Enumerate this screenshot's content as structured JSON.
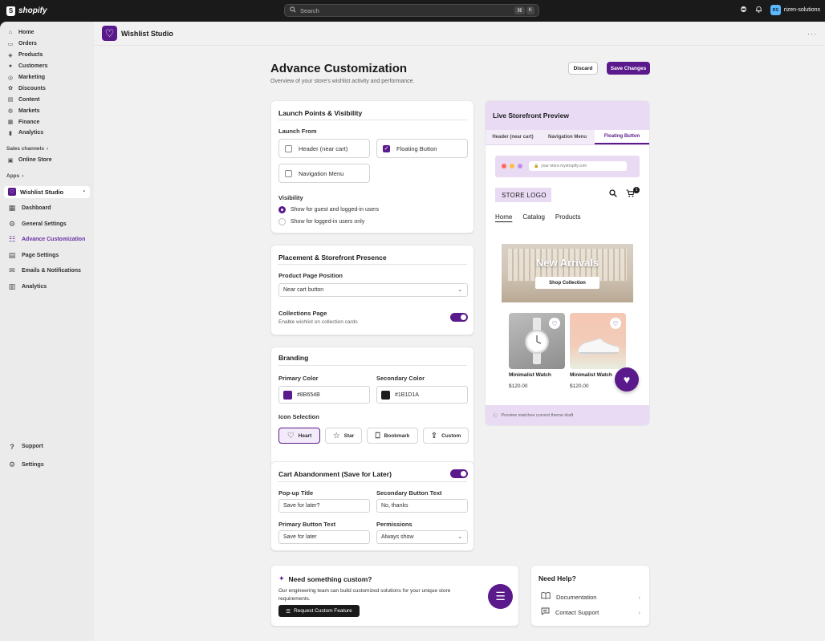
{
  "topbar": {
    "brand": "shopify",
    "search_placeholder": "Search",
    "kbd": [
      "⌘",
      "K"
    ],
    "account_initials": "RS",
    "account_name": "rizen-solutions"
  },
  "sidebar": {
    "items": [
      {
        "label": "Home",
        "icon": "⌂"
      },
      {
        "label": "Orders",
        "icon": "▭"
      },
      {
        "label": "Products",
        "icon": "◈"
      },
      {
        "label": "Customers",
        "icon": "●"
      },
      {
        "label": "Marketing",
        "icon": "◎"
      },
      {
        "label": "Discounts",
        "icon": "✿"
      },
      {
        "label": "Content",
        "icon": "▤"
      },
      {
        "label": "Markets",
        "icon": "◍"
      },
      {
        "label": "Finance",
        "icon": "▦"
      },
      {
        "label": "Analytics",
        "icon": "▮"
      }
    ],
    "sales_channels_label": "Sales channels",
    "online_store_label": "Online Store",
    "apps_label": "Apps",
    "app_name": "Wishlist Studio",
    "app_items": [
      {
        "label": "Dashboard",
        "icon": "▦"
      },
      {
        "label": "General Settings",
        "icon": "⚙"
      },
      {
        "label": "Advance Customization",
        "icon": "☷"
      },
      {
        "label": "Page Settings",
        "icon": "▤"
      },
      {
        "label": "Emails & Notifications",
        "icon": "✉"
      },
      {
        "label": "Analytics",
        "icon": "▥"
      }
    ],
    "support_label": "Support",
    "settings_label": "Settings"
  },
  "appbar": {
    "title": "Wishlist Studio"
  },
  "page": {
    "title": "Advance Customization",
    "subtitle": "Overview of your store's wishlist activity and performance.",
    "discard_label": "Discard",
    "save_label": "Save Changes"
  },
  "launch": {
    "title": "Launch Points & Visibility",
    "launch_from_label": "Launch From",
    "options": [
      {
        "label": "Header (near cart)",
        "checked": false
      },
      {
        "label": "Floating Button",
        "checked": true
      },
      {
        "label": "Navigation Menu",
        "checked": false
      }
    ],
    "visibility_label": "Visibility",
    "visibility_options": [
      "Show for guest and logged-in users",
      "Show for logged-in users only"
    ],
    "visibility_selected": 0
  },
  "placement": {
    "title": "Placement & Storefront Presence",
    "product_position_label": "Product Page Position",
    "product_position_value": "Near cart button",
    "collections_label": "Collections Page",
    "collections_desc": "Enable wishlist on collection cards",
    "collections_enabled": true
  },
  "branding": {
    "title": "Branding",
    "primary_label": "Primary Color",
    "primary_value": "#8B654B",
    "primary_color": "#5b1a8c",
    "secondary_label": "Secondary Color",
    "secondary_value": "#1B1D1A",
    "secondary_color": "#1b1d1a",
    "icon_label": "Icon Selection",
    "icons": [
      {
        "label": "Heart",
        "icon": "♡"
      },
      {
        "label": "Star",
        "icon": "☆"
      },
      {
        "label": "Bookmark",
        "icon": "⎕"
      },
      {
        "label": "Custom",
        "icon": "⇪"
      }
    ],
    "icon_selected": "Heart"
  },
  "cart": {
    "title": "Cart Abandonment (Save for Later)",
    "enabled": true,
    "popup_title_label": "Pop-up Title",
    "popup_title_value": "Save for later?",
    "secondary_btn_label": "Secondary Button Text",
    "secondary_btn_value": "No, thanks",
    "primary_btn_label": "Primary Button Text",
    "primary_btn_value": "Save for later",
    "permissions_label": "Permissions",
    "permissions_value": "Always show"
  },
  "preview": {
    "title": "Live Storefront Preview",
    "tabs": [
      "Header (near cart)",
      "Navigation Menu",
      "Floating Button"
    ],
    "active_tab": 2,
    "url": "your-store.myshopify.com",
    "store_logo": "STORE LOGO",
    "cart_count": "1",
    "nav": [
      "Home",
      "Catalog",
      "Products"
    ],
    "hero_title": "New Arrivals",
    "hero_button": "Shop Collection",
    "products": [
      {
        "name": "Minimalist Watch",
        "price": "$120.00"
      },
      {
        "name": "Minimalist Watch",
        "price": "$120.00"
      }
    ],
    "footer_note": "Preview matches current theme draft"
  },
  "custom": {
    "title": "Need something custom?",
    "desc": "Our engineering team can build customized solutions for your unique store requirements.",
    "cta": "Request Custom Feature"
  },
  "help": {
    "title": "Need Help?",
    "items": [
      {
        "label": "Documentation",
        "icon": "📖"
      },
      {
        "label": "Contact Support",
        "icon": "💬"
      }
    ]
  },
  "colors": {
    "accent": "#5b1a8c",
    "accent_light": "#e9dbf4",
    "topbar": "#1a1a1a",
    "sidebar": "#ebebeb",
    "main": "#f1f1f1"
  }
}
